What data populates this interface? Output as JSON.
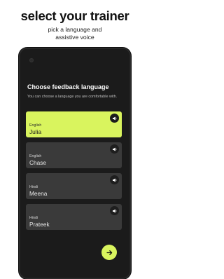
{
  "hero": {
    "title": "select your trainer",
    "subtitle_line1": "pick a language and",
    "subtitle_line2": "assistive voice"
  },
  "screen": {
    "title": "Choose feedback language",
    "description": "You can choose a language you are comfortable with."
  },
  "voices": [
    {
      "language": "English",
      "name": "Julia",
      "selected": true,
      "icon": "speaker-icon"
    },
    {
      "language": "English",
      "name": "Chase",
      "selected": false,
      "icon": "speaker-icon"
    },
    {
      "language": "Hindi",
      "name": "Meena",
      "selected": false,
      "icon": "speaker-icon"
    },
    {
      "language": "Hindi",
      "name": "Prateek",
      "selected": false,
      "icon": "speaker-icon"
    }
  ],
  "next": {
    "icon": "arrow-right-icon"
  },
  "colors": {
    "accent": "#d9f45e",
    "phone_bg": "#1b1b1b",
    "card_bg": "#3a3a3a",
    "page_bg": "#ffffff"
  }
}
